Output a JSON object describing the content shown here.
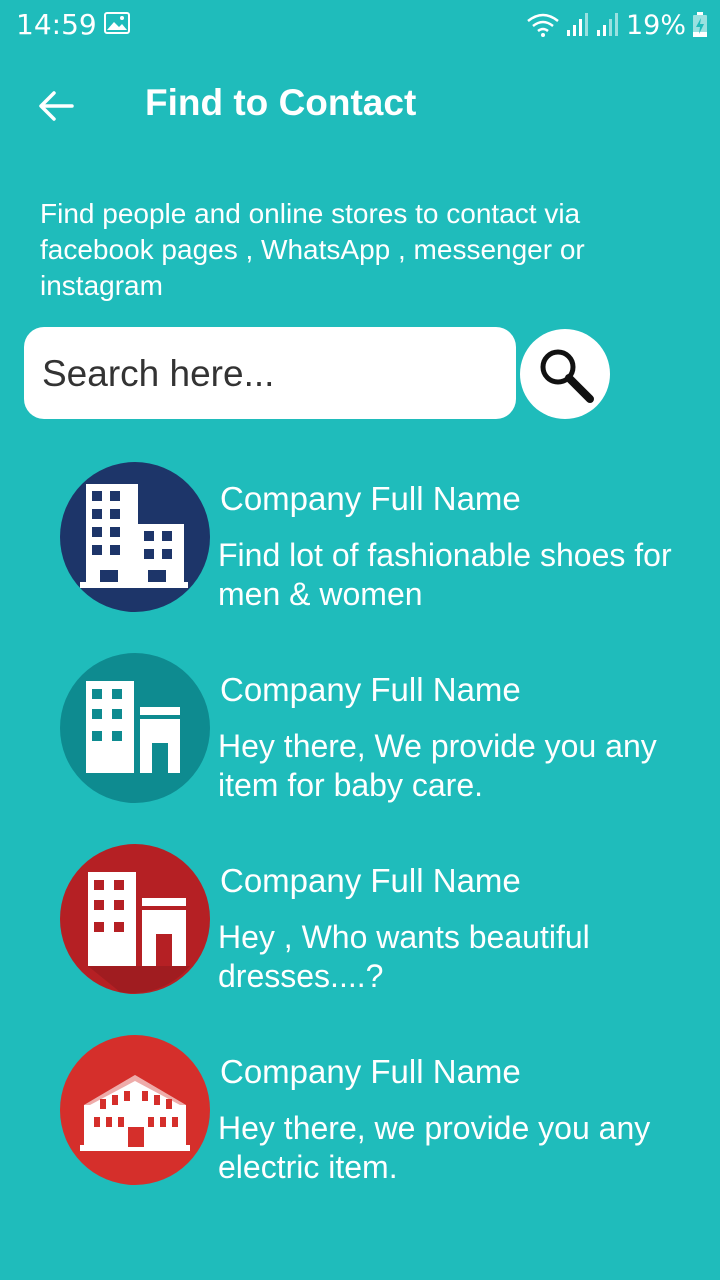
{
  "status_bar": {
    "time": "14:59",
    "battery": "19%",
    "icons": [
      "image-icon",
      "wifi-icon",
      "signal-icon",
      "signal-icon",
      "battery-charging-icon"
    ]
  },
  "app_bar": {
    "title": "Find to Contact",
    "back_icon": "arrow-left-icon"
  },
  "intro_text": "Find people and online stores to contact via facebook pages , WhatsApp , messenger or instagram",
  "search": {
    "placeholder": "Search here...",
    "value": "",
    "button_icon": "magnifier-icon"
  },
  "companies": [
    {
      "name": "Company Full Name",
      "description": "Find lot of fashionable shoes for men & women",
      "avatar_color": "#1d3569",
      "icon": "office-building-icon"
    },
    {
      "name": "Company Full Name",
      "description": "Hey there, We provide you any item for baby care.",
      "avatar_color": "#0e8b90",
      "icon": "buildings-icon"
    },
    {
      "name": "Company Full Name",
      "description": "Hey , Who wants beautiful dresses....?",
      "avatar_color": "#b52024",
      "icon": "buildings-icon"
    },
    {
      "name": "Company Full Name",
      "description": "Hey there, we provide you any electric item.",
      "avatar_color": "#d52f2b",
      "icon": "hotel-building-icon"
    }
  ],
  "colors": {
    "background": "#1fbcbb",
    "text": "#ffffff"
  }
}
